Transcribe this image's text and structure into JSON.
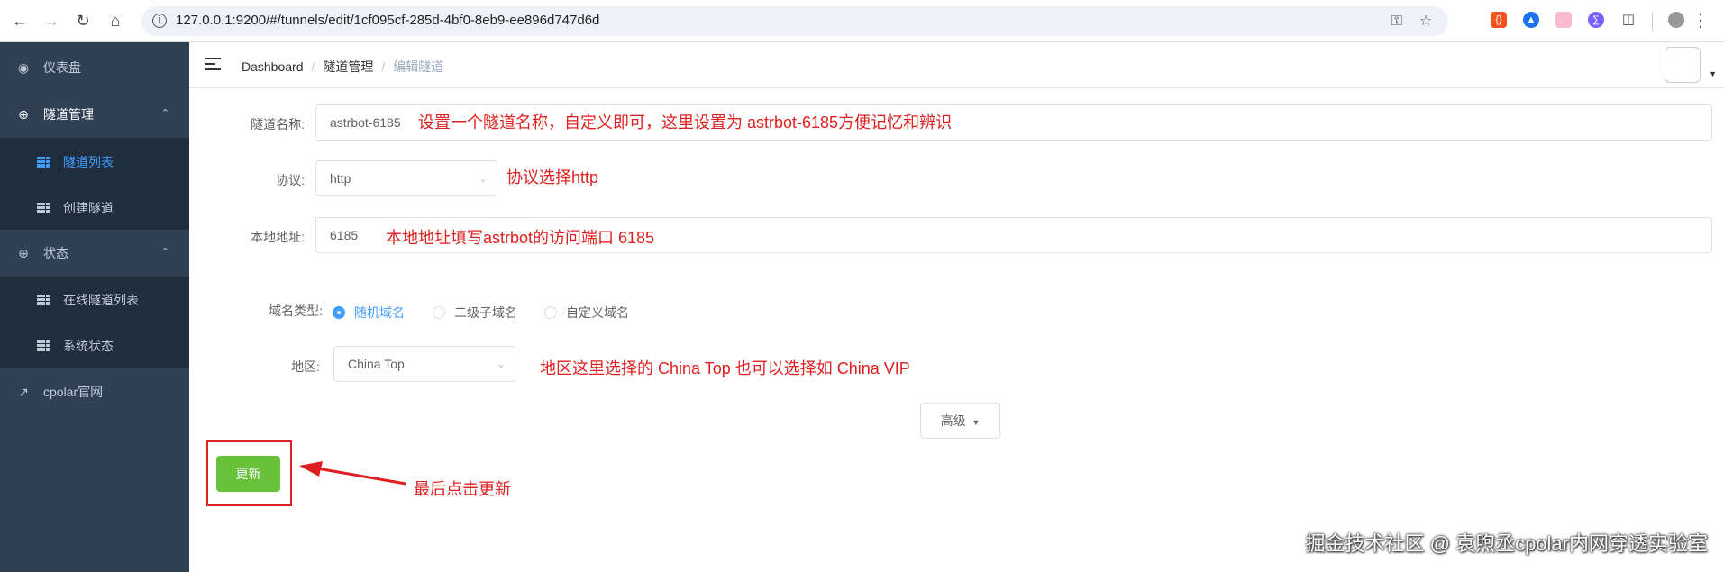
{
  "browser": {
    "url": "127.0.0.1:9200/#/tunnels/edit/1cf095cf-285d-4bf0-8eb9-ee896d747d6d",
    "colors": {
      "ext1": "#f4511e",
      "ext2": "#1a73e8",
      "ext3": "#f8bbd0",
      "ext4": "#7b61ff"
    }
  },
  "sidebar": {
    "items": [
      {
        "label": "仪表盘",
        "icon": "dashboard-icon"
      },
      {
        "label": "隧道管理",
        "icon": "plus-circle-icon"
      },
      {
        "label": "隧道列表",
        "icon": "grid-icon"
      },
      {
        "label": "创建隧道",
        "icon": "grid-icon"
      },
      {
        "label": "状态",
        "icon": "plus-circle-icon"
      },
      {
        "label": "在线隧道列表",
        "icon": "grid-icon"
      },
      {
        "label": "系统状态",
        "icon": "grid-icon"
      },
      {
        "label": "cpolar官网",
        "icon": "external-link-icon"
      }
    ]
  },
  "breadcrumb": [
    "Dashboard",
    "隧道管理",
    "编辑隧道"
  ],
  "form": {
    "name_label": "隧道名称:",
    "name_value": "astrbot-6185",
    "protocol_label": "协议:",
    "protocol_value": "http",
    "local_label": "本地地址:",
    "local_value": "6185",
    "domain_label": "域名类型:",
    "domain_options": [
      "随机域名",
      "二级子域名",
      "自定义域名"
    ],
    "domain_selected": "随机域名",
    "region_label": "地区:",
    "region_value": "China Top",
    "advanced_label": "高级",
    "update_label": "更新"
  },
  "annotations": {
    "name_note": "设置一个隧道名称，自定义即可，这里设置为 astrbot-6185方便记忆和辨识",
    "protocol_note": "协议选择http",
    "local_note": "本地地址填写astrbot的访问端口 6185",
    "region_note": "地区这里选择的 China Top 也可以选择如 China VIP",
    "update_note": "最后点击更新"
  },
  "watermark": "掘金技术社区 @ 袁煦丞cpolar内网穿透实验室",
  "colors": {
    "sidebar_bg": "#304156",
    "active": "#409eff",
    "update_btn": "#67c23a",
    "annotation": "#e02020"
  }
}
